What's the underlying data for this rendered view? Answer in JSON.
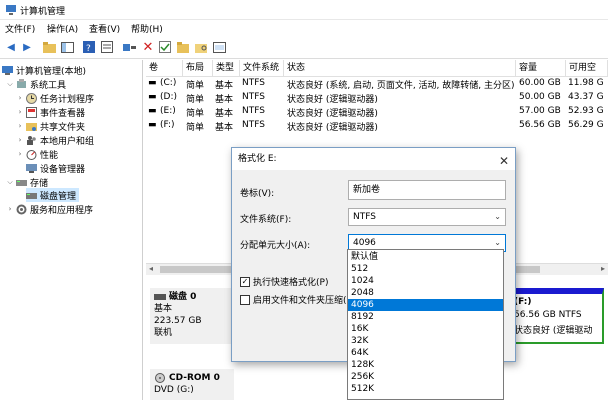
{
  "window": {
    "title": "计算机管理"
  },
  "menu": [
    "文件(F)",
    "操作(A)",
    "查看(V)",
    "帮助(H)"
  ],
  "toolbar": {
    "icons": [
      "back-arrow-icon",
      "forward-arrow-icon",
      "up-folder-icon",
      "console-tree-icon",
      "help-icon",
      "properties-icon",
      "delete-icon",
      "check-icon",
      "folder-open-icon",
      "folder-search-icon",
      "list-view-icon"
    ]
  },
  "tree": {
    "items": [
      {
        "label": "计算机管理(本地)",
        "level": 0,
        "expander": "",
        "icon": "computer-icon"
      },
      {
        "label": "系统工具",
        "level": 1,
        "expander": "v",
        "icon": "tools-icon"
      },
      {
        "label": "任务计划程序",
        "level": 2,
        "expander": ">",
        "icon": "clock-icon"
      },
      {
        "label": "事件查看器",
        "level": 2,
        "expander": ">",
        "icon": "event-icon"
      },
      {
        "label": "共享文件夹",
        "level": 2,
        "expander": ">",
        "icon": "shared-folder-icon"
      },
      {
        "label": "本地用户和组",
        "level": 2,
        "expander": ">",
        "icon": "users-icon"
      },
      {
        "label": "性能",
        "level": 2,
        "expander": ">",
        "icon": "performance-icon"
      },
      {
        "label": "设备管理器",
        "level": 2,
        "expander": "",
        "icon": "device-manager-icon"
      },
      {
        "label": "存储",
        "level": 1,
        "expander": "v",
        "icon": "storage-icon"
      },
      {
        "label": "磁盘管理",
        "level": 2,
        "expander": "",
        "icon": "disk-icon",
        "selected": true
      },
      {
        "label": "服务和应用程序",
        "level": 1,
        "expander": ">",
        "icon": "services-icon"
      }
    ]
  },
  "volumes": {
    "columns": [
      "卷",
      "布局",
      "类型",
      "文件系统",
      "状态",
      "容量",
      "可用空"
    ],
    "rows": [
      [
        "(C:)",
        "简单",
        "基本",
        "NTFS",
        "状态良好 (系统, 启动, 页面文件, 活动, 故障转储, 主分区)",
        "60.00 GB",
        "11.98 G"
      ],
      [
        "(D:)",
        "简单",
        "基本",
        "NTFS",
        "状态良好 (逻辑驱动器)",
        "50.00 GB",
        "43.37 G"
      ],
      [
        "(E:)",
        "简单",
        "基本",
        "NTFS",
        "状态良好 (逻辑驱动器)",
        "57.00 GB",
        "52.93 G"
      ],
      [
        "(F:)",
        "简单",
        "基本",
        "NTFS",
        "状态良好 (逻辑驱动器)",
        "56.56 GB",
        "56.29 G"
      ]
    ]
  },
  "disks": [
    {
      "name": "磁盘 0",
      "type": "基本",
      "size": "223.57 GB",
      "status": "联机"
    },
    {
      "name": "CD-ROM 0",
      "type": "DVD (G:)",
      "size": "",
      "status": ""
    }
  ],
  "partition_f": {
    "name": "(F:)",
    "detail": "56.56 GB NTFS",
    "status": "状态良好 (逻辑驱动"
  },
  "dialog": {
    "title": "格式化 E:",
    "close": "✕",
    "label_volume": "卷标(V):",
    "volume_value": "新加卷",
    "label_fs": "文件系统(F):",
    "fs_value": "NTFS",
    "label_alloc": "分配单元大小(A):",
    "alloc_value": "4096",
    "quick_format": "执行快速格式化(P)",
    "quick_format_checked": true,
    "compression": "启用文件和文件夹压缩(E)",
    "compression_checked": false
  },
  "dropdown": {
    "options": [
      "默认值",
      "512",
      "1024",
      "2048",
      "4096",
      "8192",
      "16K",
      "32K",
      "64K",
      "128K",
      "256K",
      "512K"
    ],
    "highlighted": "4096"
  }
}
